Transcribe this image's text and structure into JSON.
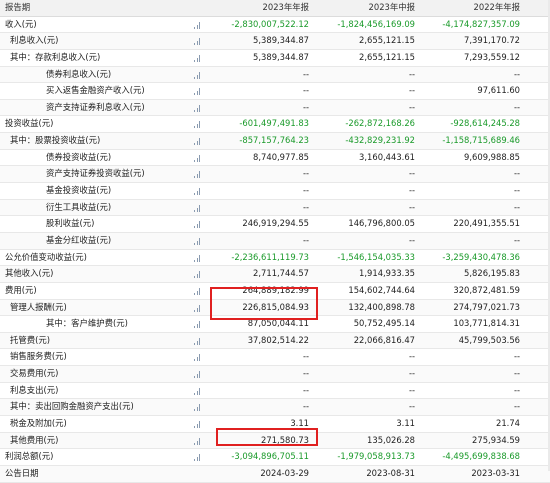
{
  "header": {
    "label": "报告期",
    "periods": [
      "2023年年报",
      "2023年中报",
      "2022年年报"
    ]
  },
  "rows": [
    {
      "label": "收入(元)",
      "values": [
        "-2,830,007,522.12",
        "-1,824,456,169.09",
        "-4,174,827,357.09"
      ],
      "negative": [
        true,
        true,
        true
      ],
      "chart": true
    },
    {
      "label": "利息收入(元)",
      "values": [
        "5,389,344.87",
        "2,655,121.15",
        "7,391,170.72"
      ],
      "negative": [
        false,
        false,
        false
      ],
      "chart": true
    },
    {
      "label": "其中：存款利息收入(元)",
      "values": [
        "5,389,344.87",
        "2,655,121.15",
        "7,293,559.12"
      ],
      "negative": [
        false,
        false,
        false
      ],
      "chart": true
    },
    {
      "label": "债券利息收入(元)",
      "values": [
        "--",
        "--",
        "--"
      ],
      "negative": [
        false,
        false,
        false
      ],
      "chart": true
    },
    {
      "label": "买入返售金融资产收入(元)",
      "values": [
        "--",
        "--",
        "97,611.60"
      ],
      "negative": [
        false,
        false,
        false
      ],
      "chart": true
    },
    {
      "label": "资产支持证券利息收入(元)",
      "values": [
        "--",
        "--",
        "--"
      ],
      "negative": [
        false,
        false,
        false
      ],
      "chart": true
    },
    {
      "label": "投资收益(元)",
      "values": [
        "-601,497,491.83",
        "-262,872,168.26",
        "-928,614,245.28"
      ],
      "negative": [
        true,
        true,
        true
      ],
      "chart": true
    },
    {
      "label": "其中：股票投资收益(元)",
      "values": [
        "-857,157,764.23",
        "-432,829,231.92",
        "-1,158,715,689.46"
      ],
      "negative": [
        true,
        true,
        true
      ],
      "chart": true
    },
    {
      "label": "债券投资收益(元)",
      "values": [
        "8,740,977.85",
        "3,160,443.61",
        "9,609,988.85"
      ],
      "negative": [
        false,
        false,
        false
      ],
      "chart": true
    },
    {
      "label": "资产支持证券投资收益(元)",
      "values": [
        "--",
        "--",
        "--"
      ],
      "negative": [
        false,
        false,
        false
      ],
      "chart": true
    },
    {
      "label": "基金投资收益(元)",
      "values": [
        "--",
        "--",
        "--"
      ],
      "negative": [
        false,
        false,
        false
      ],
      "chart": true
    },
    {
      "label": "衍生工具收益(元)",
      "values": [
        "--",
        "--",
        "--"
      ],
      "negative": [
        false,
        false,
        false
      ],
      "chart": true
    },
    {
      "label": "股利收益(元)",
      "values": [
        "246,919,294.55",
        "146,796,800.05",
        "220,491,355.51"
      ],
      "negative": [
        false,
        false,
        false
      ],
      "chart": true
    },
    {
      "label": "基金分红收益(元)",
      "values": [
        "--",
        "--",
        "--"
      ],
      "negative": [
        false,
        false,
        false
      ],
      "chart": true
    },
    {
      "label": "公允价值变动收益(元)",
      "values": [
        "-2,236,611,119.73",
        "-1,546,154,035.33",
        "-3,259,430,478.36"
      ],
      "negative": [
        true,
        true,
        true
      ],
      "chart": true
    },
    {
      "label": "其他收入(元)",
      "values": [
        "2,711,744.57",
        "1,914,933.35",
        "5,826,195.83"
      ],
      "negative": [
        false,
        false,
        false
      ],
      "chart": true
    },
    {
      "label": "费用(元)",
      "values": [
        "264,889,182.99",
        "154,602,744.64",
        "320,872,481.59"
      ],
      "negative": [
        false,
        false,
        false
      ],
      "chart": true
    },
    {
      "label": "管理人报酬(元)",
      "values": [
        "226,815,084.93",
        "132,400,898.78",
        "274,797,021.73"
      ],
      "negative": [
        false,
        false,
        false
      ],
      "chart": true
    },
    {
      "label": "其中：客户维护费(元)",
      "values": [
        "87,050,044.11",
        "50,752,495.14",
        "103,771,814.31"
      ],
      "negative": [
        false,
        false,
        false
      ],
      "chart": true
    },
    {
      "label": "托管费(元)",
      "values": [
        "37,802,514.22",
        "22,066,816.47",
        "45,799,503.56"
      ],
      "negative": [
        false,
        false,
        false
      ],
      "chart": true
    },
    {
      "label": "销售服务费(元)",
      "values": [
        "--",
        "--",
        "--"
      ],
      "negative": [
        false,
        false,
        false
      ],
      "chart": true
    },
    {
      "label": "交易费用(元)",
      "values": [
        "--",
        "--",
        "--"
      ],
      "negative": [
        false,
        false,
        false
      ],
      "chart": true
    },
    {
      "label": "利息支出(元)",
      "values": [
        "--",
        "--",
        "--"
      ],
      "negative": [
        false,
        false,
        false
      ],
      "chart": true
    },
    {
      "label": "其中：卖出回购金融资产支出(元)",
      "values": [
        "--",
        "--",
        "--"
      ],
      "negative": [
        false,
        false,
        false
      ],
      "chart": true
    },
    {
      "label": "税金及附加(元)",
      "values": [
        "3.11",
        "3.11",
        "21.74"
      ],
      "negative": [
        false,
        false,
        false
      ],
      "chart": true
    },
    {
      "label": "其他费用(元)",
      "values": [
        "271,580.73",
        "135,026.28",
        "275,934.59"
      ],
      "negative": [
        false,
        false,
        false
      ],
      "chart": true
    },
    {
      "label": "利润总额(元)",
      "values": [
        "-3,094,896,705.11",
        "-1,979,058,913.73",
        "-4,495,699,838.68"
      ],
      "negative": [
        true,
        true,
        true
      ],
      "chart": true
    },
    {
      "label": "公告日期",
      "values": [
        "2024-03-29",
        "2023-08-31",
        "2023-03-31"
      ],
      "negative": [
        false,
        false,
        false
      ],
      "chart": false
    }
  ],
  "colors": {
    "negative": "#1a9a2a",
    "highlight_border": "#e02020",
    "header_bg": "#f2f2f2"
  }
}
